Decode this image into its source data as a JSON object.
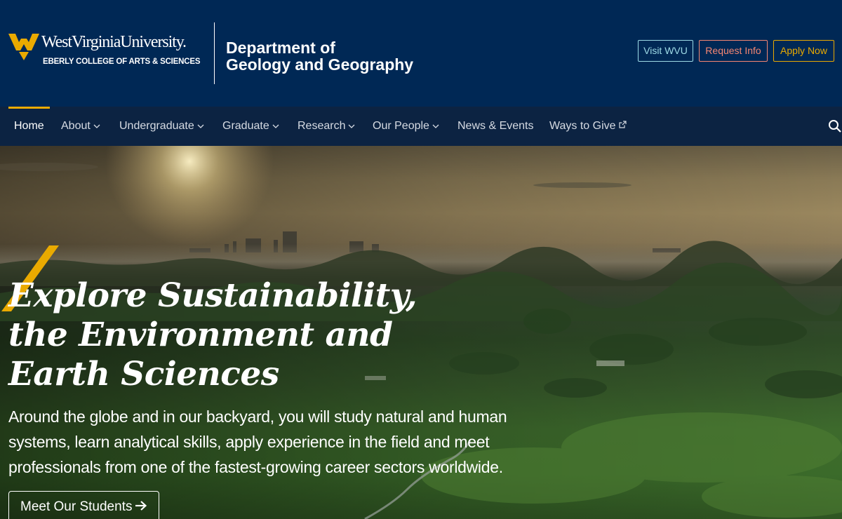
{
  "header": {
    "university": "WestVirginiaUniversity.",
    "college": "EBERLY COLLEGE OF ARTS & SCIENCES",
    "department_line1": "Department of",
    "department_line2": "Geology and Geography",
    "buttons": {
      "visit": "Visit WVU",
      "request": "Request Info",
      "apply": "Apply Now"
    }
  },
  "nav": {
    "items": [
      {
        "label": "Home",
        "active": true
      },
      {
        "label": "About",
        "dropdown": true
      },
      {
        "label": "Undergraduate",
        "dropdown": true
      },
      {
        "label": "Graduate",
        "dropdown": true
      },
      {
        "label": "Research",
        "dropdown": true
      },
      {
        "label": "Our People",
        "dropdown": true
      },
      {
        "label": "News & Events"
      },
      {
        "label": "Ways to Give",
        "external": true
      }
    ]
  },
  "hero": {
    "title_line1": "Explore Sustainability,",
    "title_line2": "the Environment and",
    "title_line3": "Earth Sciences",
    "description": "Around the globe and in our backyard, you will study natural and human systems, learn analytical skills, apply experience in the field and meet professionals from one of the fastest-growing career sectors worldwide.",
    "cta": "Meet Our Students"
  },
  "colors": {
    "navy": "#002855",
    "nav_bg": "#0c2342",
    "gold": "#eaaa00",
    "visit_btn": "#9ddae6",
    "request_btn": "#f58672"
  },
  "icons": {
    "logo": "flying-wv-icon",
    "chevron": "chevron-down-icon",
    "external": "external-link-icon",
    "search": "search-icon",
    "arrow": "arrow-right-icon"
  }
}
